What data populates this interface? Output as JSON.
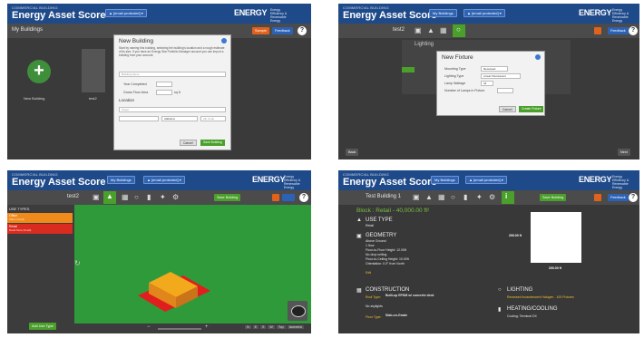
{
  "common": {
    "brand_small": "COMMERCIAL BUILDING",
    "brand": "Energy Asset Score",
    "energy_logo": "ENERGY",
    "energy_sub": "Energy Efficiency & Renewable Energy",
    "my_buildings": "My Buildings",
    "user_email": "▲ [email protected] ▾",
    "feedback": "Feedback",
    "help": "?"
  },
  "panel1": {
    "subbar_title": "My Buildings",
    "sample_btn": "Sample",
    "new_building_label": "New Building",
    "tile_label": "test2",
    "modal": {
      "title": "New Building",
      "intro": "Start by naming this building, selecting the building's location and a rough estimate of its size. If you have an Energy Star Portfolio Manager account you can import a building from your account.",
      "name_placeholder": "Building Name",
      "year_label": "Year Completed",
      "floor_label": "Gross Floor Area",
      "floor_unit": "sq ft",
      "location_head": "Location",
      "street_placeholder": "Street",
      "state_select": "Alabama",
      "zip_placeholder": "Zip Code",
      "cancel": "Cancel",
      "save": "Save Building"
    }
  },
  "panel2": {
    "building_name": "test2",
    "section_title": "Lighting",
    "modal": {
      "title": "New Fixture",
      "mounting_label": "Mounting Type",
      "mounting_value": "Recessed",
      "lighting_label": "Lighting Type",
      "lighting_value": "Linear Fluorescent",
      "lamp_label": "Lamp Wattage",
      "lamp_value": "32",
      "count_label": "Number of Lamps in Fixture",
      "cancel": "Cancel",
      "create": "Create Fixture"
    },
    "back_btn": "Back",
    "next_btn": "Next"
  },
  "panel3": {
    "building_name": "test2",
    "save_btn": "Save Building",
    "use_types_head": "USE TYPES",
    "items": [
      {
        "label": "Office",
        "sub": "Office (Small)",
        "color": "#f08a1a"
      },
      {
        "label": "Retail",
        "sub": "Retail Store (Small)",
        "color": "#d92b20"
      }
    ],
    "add_btn": "Add Use Type",
    "view_labels": [
      "N",
      "E",
      "S",
      "W",
      "Top",
      "Isometric"
    ]
  },
  "panel4": {
    "building_name": "Test Building 1",
    "block_title": "Block : Retail - 40,000.00 ft²",
    "use_type_head": "USE TYPE",
    "use_type_value": "Retail",
    "geometry_head": "GEOMETRY",
    "geometry_lines": [
      "Above Ground",
      "1 floor",
      "Floor-to-Floor Height: 12.00ft",
      "No drop ceiling",
      "Floor-to-Ceiling Height: 10.00ft",
      "Orientation: 0.0° from North"
    ],
    "edit": "Edit",
    "dim_top": "200.00 ft",
    "dim_side": "200.00 ft",
    "construction_head": "CONSTRUCTION",
    "roof_line": "Built-up EPDM w/ concrete deck",
    "roof_prefix": "Roof Type:",
    "skylight": "No skylights",
    "floor_prefix": "Floor Type:",
    "floor_line": "Slab-on-Grade",
    "lighting_head": "LIGHTING",
    "lighting_line": "Recessed Incandescent Halogen - 100 Fixtures",
    "heating_head": "HEATING/COOLING",
    "cooling_line": "Cooling: Terminal DX"
  },
  "colors": {
    "header_blue": "#1f4a8a",
    "accent_green": "#4aa02b",
    "accent_orange": "#e0621d",
    "viewport_green": "#2f9a3a"
  }
}
